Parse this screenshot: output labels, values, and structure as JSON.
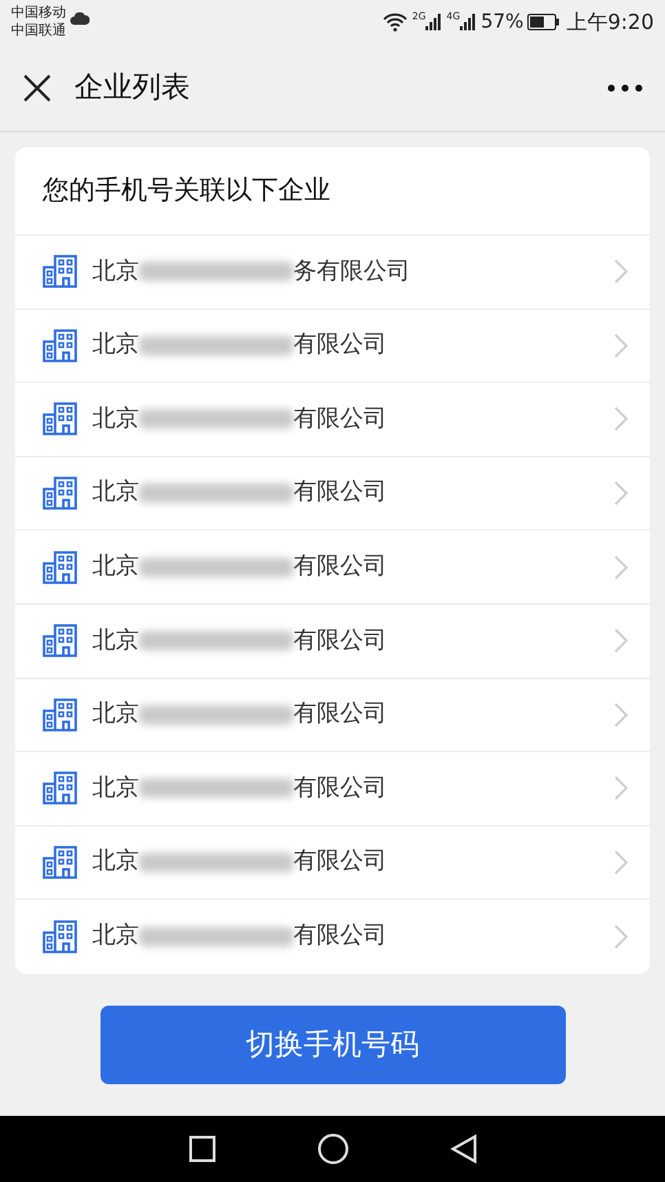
{
  "status_bar": {
    "carriers": [
      "中国移动",
      "中国联通"
    ],
    "network_1": "2G",
    "network_2": "4G",
    "battery": "57%",
    "time": "上午9:20"
  },
  "header": {
    "title": "企业列表"
  },
  "card": {
    "heading": "您的手机号关联以下企业",
    "companies": [
      {
        "prefix": "北京",
        "suffix": "务有限公司"
      },
      {
        "prefix": "北京",
        "suffix": "有限公司"
      },
      {
        "prefix": "北京",
        "suffix": "有限公司"
      },
      {
        "prefix": "北京",
        "suffix": "有限公司"
      },
      {
        "prefix": "北京",
        "suffix": "有限公司"
      },
      {
        "prefix": "北京",
        "suffix": "有限公司"
      },
      {
        "prefix": "北京",
        "suffix": "有限公司"
      },
      {
        "prefix": "北京",
        "suffix": "有限公司"
      },
      {
        "prefix": "北京",
        "suffix": "有限公司"
      },
      {
        "prefix": "北京",
        "suffix": "有限公司"
      }
    ]
  },
  "switch_button": "切换手机号码"
}
